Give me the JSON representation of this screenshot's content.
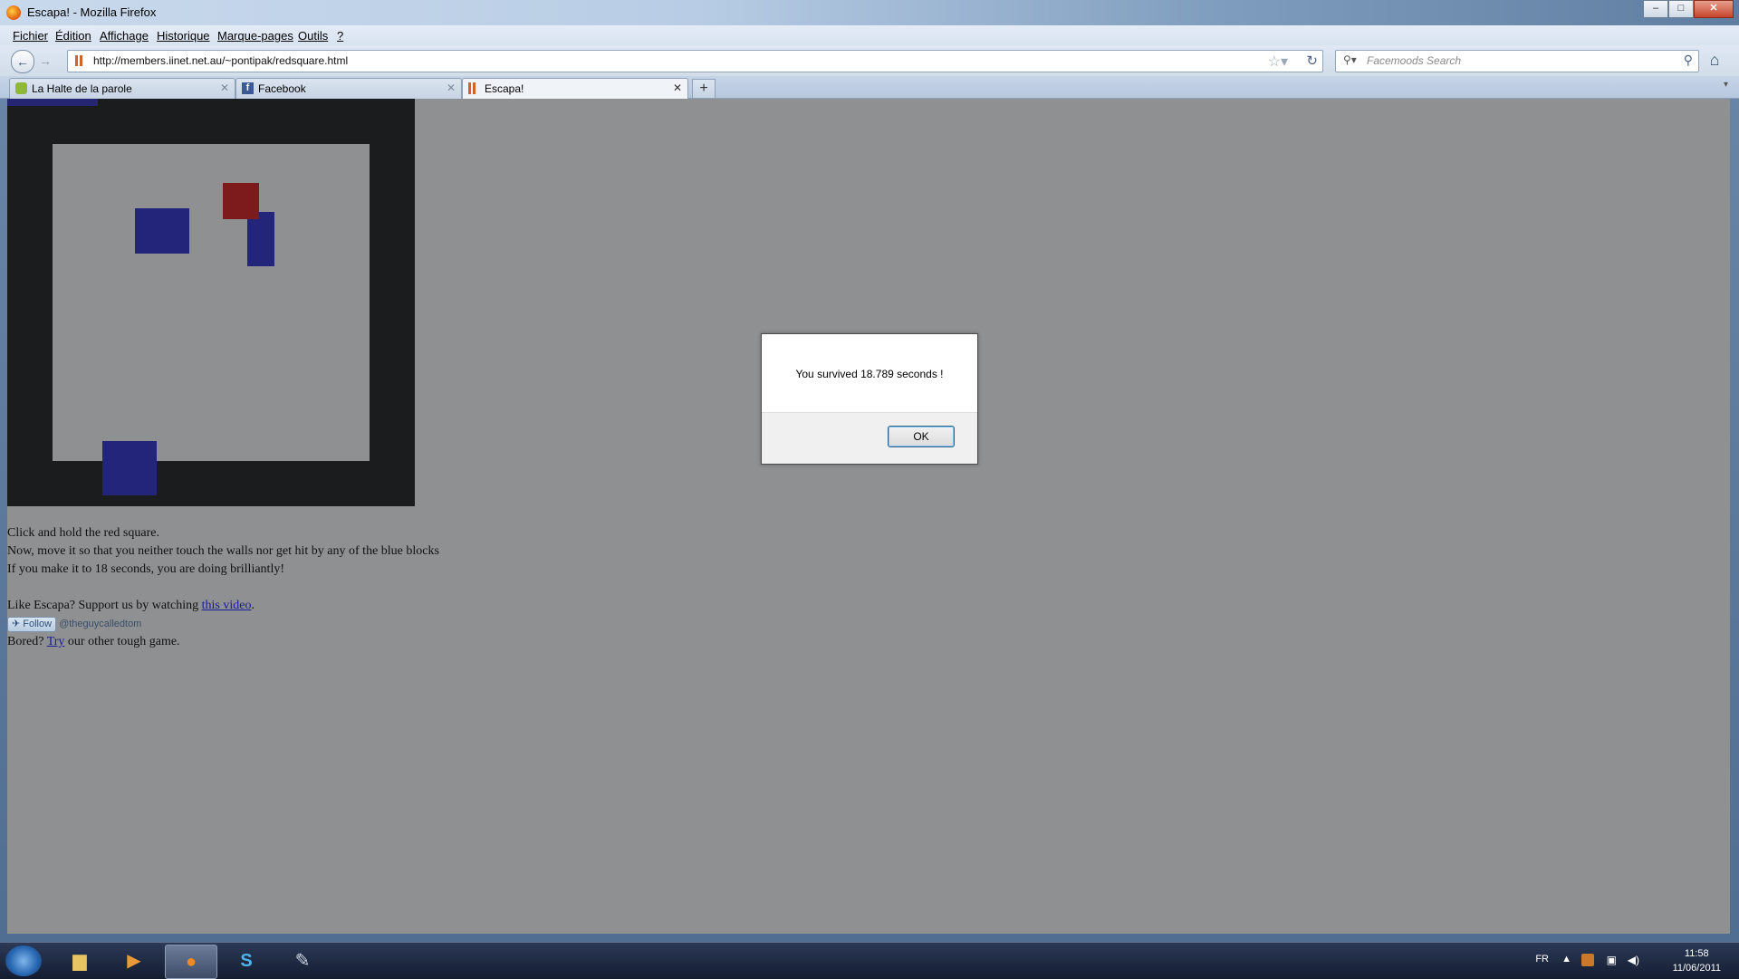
{
  "window": {
    "title": "Escapa! - Mozilla Firefox",
    "controls": {
      "minimize": "–",
      "maximize": "□",
      "close": "✕"
    }
  },
  "menu": [
    "Fichier",
    "Édition",
    "Affichage",
    "Historique",
    "Marque-pages",
    "Outils",
    "?"
  ],
  "navbar": {
    "back": "←",
    "forward": "→",
    "url": "http://members.iinet.net.au/~pontipak/redsquare.html",
    "search_placeholder": "Facemoods Search"
  },
  "tabs": [
    {
      "label": "La Halte de la parole",
      "icon": "speech-bubble-icon",
      "active": false
    },
    {
      "label": "Facebook",
      "icon": "facebook-icon",
      "active": false
    },
    {
      "label": "Escapa!",
      "icon": "site-icon",
      "active": true
    }
  ],
  "game": {
    "wall_color": "#1b1c1d",
    "floor_color": "#8e9091",
    "red_color": "#7d1b1c",
    "blue_color": "#23257a"
  },
  "page": {
    "line1": "Click and hold the red square.",
    "line2": "Now, move it so that you neither touch the walls nor get hit by any of the blue blocks",
    "line3": "If you make it to 18 seconds, you are doing brilliantly!",
    "support_prefix": "Like Escapa? Support us by watching ",
    "support_link": "this video",
    "support_suffix": ".",
    "follow_label": "Follow",
    "follow_handle": "@theguycalledtom",
    "bored_prefix": "Bored? ",
    "bored_link": "Try",
    "bored_suffix": " our other tough game."
  },
  "dialog": {
    "message": "You survived 18.789 seconds !",
    "ok_label": "OK"
  },
  "taskbar": {
    "lang": "FR",
    "time": "11:58",
    "date": "11/06/2011"
  }
}
